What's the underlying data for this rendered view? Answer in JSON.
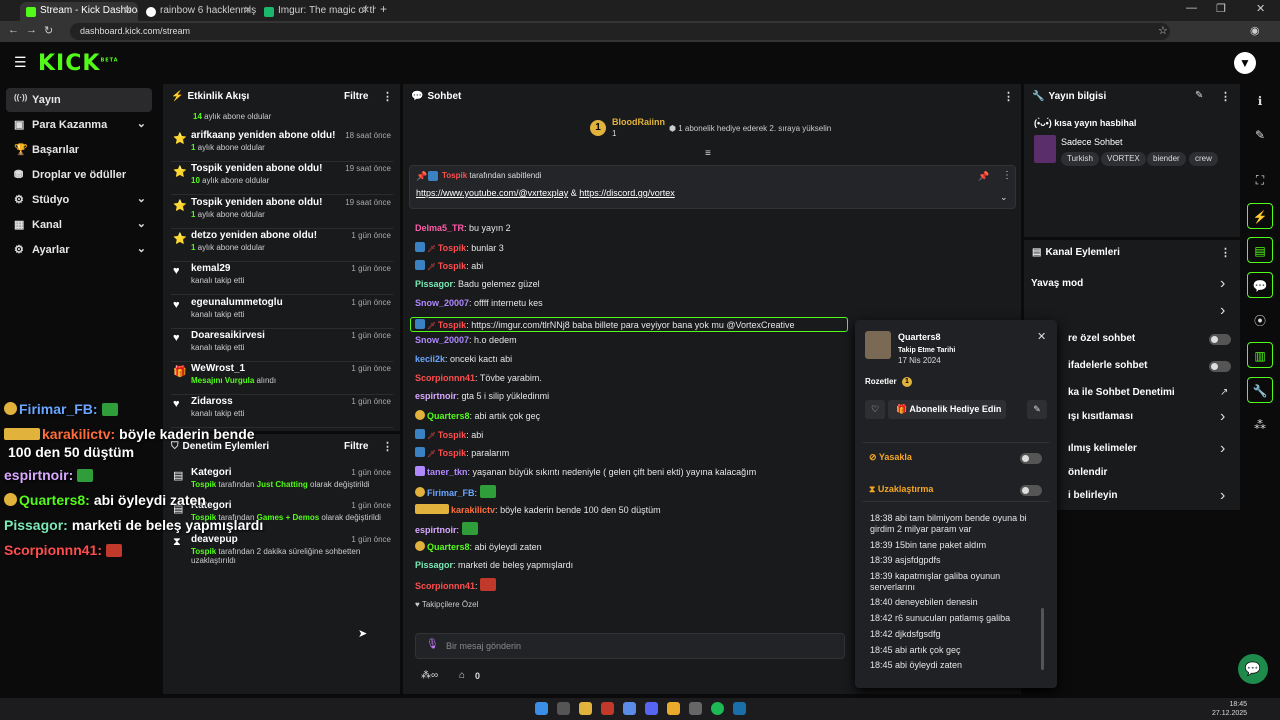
{
  "browser": {
    "tabs": [
      {
        "label": "Stream - Kick Dashboard",
        "color": "#53fc18",
        "active": true
      },
      {
        "label": "rainbow 6 hacklenmiş - Google",
        "color": "#4285f4",
        "active": false
      },
      {
        "label": "Imgur: The magic of the Interne",
        "color": "#1bb76e",
        "active": false
      }
    ],
    "url": "dashboard.kick.com/stream"
  },
  "brand": {
    "logo": "KICK",
    "beta": "BETA"
  },
  "leftnav": [
    {
      "label": "Yayın",
      "icon": "broadcast-icon",
      "glyph": "((·))",
      "chevron": false,
      "active": true
    },
    {
      "label": "Para Kazanma",
      "icon": "money-icon",
      "glyph": "▣",
      "chevron": true
    },
    {
      "label": "Başarılar",
      "icon": "trophy-icon",
      "glyph": "🏆",
      "chevron": false
    },
    {
      "label": "Droplar ve ödüller",
      "icon": "gift-icon",
      "glyph": "⛃",
      "chevron": false
    },
    {
      "label": "Stüdyo",
      "icon": "studio-icon",
      "glyph": "⚙",
      "chevron": true
    },
    {
      "label": "Kanal",
      "icon": "channel-icon",
      "glyph": "▦",
      "chevron": true
    },
    {
      "label": "Ayarlar",
      "icon": "settings-icon",
      "glyph": "⚙",
      "chevron": true
    }
  ],
  "activity": {
    "title": "Etkinlik Akışı",
    "filter": "Filtre",
    "top_line": {
      "bold": "14",
      "rest": " aylık abone oldular"
    },
    "items": [
      {
        "t1": "arifkaanp yeniden abone oldu!",
        "b": "1",
        "t2": " aylık abone oldular",
        "time": "18 saat önce",
        "icon": "star"
      },
      {
        "t1": "Tospik yeniden abone oldu!",
        "b": "10",
        "t2": " aylık abone oldular",
        "time": "19 saat önce",
        "icon": "star"
      },
      {
        "t1": "Tospik yeniden abone oldu!",
        "b": "1",
        "t2": " aylık abone oldular",
        "time": "19 saat önce",
        "icon": "star"
      },
      {
        "t1": "detzo yeniden abone oldu!",
        "b": "1",
        "t2": " aylık abone oldular",
        "time": "1 gün önce",
        "icon": "star"
      },
      {
        "t1": "kemal29",
        "b": "",
        "t2": "kanalı takip etti",
        "time": "1 gün önce",
        "icon": "heart"
      },
      {
        "t1": "egeunalummetoglu",
        "b": "",
        "t2": "kanalı takip etti",
        "time": "1 gün önce",
        "icon": "heart"
      },
      {
        "t1": "Doaresaikirvesi",
        "b": "",
        "t2": "kanalı takip etti",
        "time": "1 gün önce",
        "icon": "heart"
      },
      {
        "t1": "WeWrost_1",
        "b": "Mesajını Vurgula",
        "t2": " alındı",
        "time": "1 gün önce",
        "icon": "gift"
      },
      {
        "t1": "Zidaross",
        "b": "",
        "t2": "kanalı takip etti",
        "time": "1 gün önce",
        "icon": "heart"
      }
    ]
  },
  "moderation": {
    "title": "Denetim Eylemleri",
    "filter": "Filtre",
    "items": [
      {
        "t1": "Kategori",
        "b": "Tospik",
        "m": " tarafından ",
        "g": "Just Chatting",
        "e": " olarak değiştirildi",
        "time": "1 gün önce"
      },
      {
        "t1": "Kategori",
        "b": "Tospik",
        "m": " tarafından ",
        "g": "Games + Demos",
        "e": " olarak değiştirildi",
        "time": "1 gün önce"
      },
      {
        "t1": "deavepup",
        "b": "Tospik",
        "m": " tarafından 2 dakika süreliğine sohbetten",
        "g": "",
        "e": "uzaklaştırıldı",
        "time": "1 gün önce"
      }
    ]
  },
  "overlay": [
    {
      "user": "Firimar_FB:",
      "color": "#6aa6ff",
      "text": "",
      "emote": "#2f9e3a"
    },
    {
      "user": "karakilictv:",
      "color": "#ff6d3a",
      "text": "böyle kaderin bende",
      "emote": ""
    },
    {
      "user": "",
      "color": "#fff",
      "text": "100 den 50 düştüm",
      "emote": ""
    },
    {
      "user": "espirtnoir:",
      "color": "#d9a8ff",
      "text": "",
      "emote": "#2f9e3a"
    },
    {
      "user": "Quarters8:",
      "color": "#53fc18",
      "text": "abi öyleydi zaten",
      "emote": ""
    },
    {
      "user": "Pissagor:",
      "color": "#7be8b5",
      "text": "marketi de beleş yapmışlardı",
      "emote": ""
    },
    {
      "user": "Scorpionnn41:",
      "color": "#ff4d4d",
      "text": "",
      "emote": "#c0392b"
    }
  ],
  "chat": {
    "title": "Sohbet",
    "gift_user": "BloodRaiinn",
    "gift_count": "1",
    "gift_text": "1 abonelik hediye ederek 2. sıraya yükselin",
    "pinned_by": "Tospik",
    "pinned_suffix": " tarafından sabitlendi",
    "pinned_link1": "https://www.youtube.com/@vxrtexplay",
    "pinned_amp": " & ",
    "pinned_link2": "https://discord.gg/vortex",
    "messages": [
      {
        "user": "Delma5_TR",
        "color": "#ff5ca8",
        "text": "bu yayın 2",
        "mod": false
      },
      {
        "user": "Tospik",
        "color": "#ff4d4d",
        "text": "bunlar 3",
        "mod": true
      },
      {
        "user": "Tospik",
        "color": "#ff4d4d",
        "text": "abi",
        "mod": true
      },
      {
        "user": "Pissagor",
        "color": "#7be8b5",
        "text": "Badu gelemez güzel",
        "mod": false
      },
      {
        "user": "Snow_20007",
        "color": "#b088ff",
        "text": "offff internetu kes",
        "mod": false
      },
      {
        "user": "Tospik",
        "color": "#ff4d4d",
        "text": "https://imgur.com/tlrNNj8 baba billete para veyiyor bana yok mu @VortexCreative",
        "mod": true,
        "highlight": true
      },
      {
        "user": "Snow_20007",
        "color": "#b088ff",
        "text": "h.o dedem",
        "mod": false
      },
      {
        "user": "kecii2k",
        "color": "#6aa6ff",
        "text": "onceki kactı abi",
        "mod": false
      },
      {
        "user": "Scorpionnn41",
        "color": "#ff4d4d",
        "text": "Tövbe yarabim.",
        "mod": false
      },
      {
        "user": "espirtnoir",
        "color": "#d9a8ff",
        "text": "gta 5 i silip yükledinmi",
        "mod": false
      },
      {
        "user": "Quarters8",
        "color": "#53fc18",
        "text": "abi artık çok geç",
        "mod": false
      },
      {
        "user": "Tospik",
        "color": "#ff4d4d",
        "text": "abi",
        "mod": true
      },
      {
        "user": "Tospik",
        "color": "#ff4d4d",
        "text": "paralarım",
        "mod": true
      },
      {
        "user": "taner_tkn",
        "color": "#b088ff",
        "text": "yaşanan büyük sıkıntı nedeniyle ( gelen çift beni ekti) yayına kalacağım",
        "mod": false
      },
      {
        "user": "Firimar_FB",
        "color": "#6aa6ff",
        "text": "",
        "mod": false
      },
      {
        "user": "karakilictv",
        "color": "#ff6d3a",
        "text": "böyle kaderin bende 100 den 50 düştüm",
        "mod": false
      },
      {
        "user": "espirtnoir",
        "color": "#d9a8ff",
        "text": "",
        "mod": false
      },
      {
        "user": "Quarters8",
        "color": "#53fc18",
        "text": "abi öyleydi zaten",
        "mod": false
      },
      {
        "user": "Pissagor",
        "color": "#7be8b5",
        "text": "marketi de beleş yapmışlardı",
        "mod": false
      },
      {
        "user": "Scorpionnn41",
        "color": "#ff4d4d",
        "text": "",
        "mod": false
      }
    ],
    "followers_only": "Takipçilere Özel",
    "input_placeholder": "Bir mesaj gönderin",
    "points": "0"
  },
  "stream_info": {
    "title": "Yayın bilgisi",
    "stream_title": "(•̀ᴗ•́) kısa yayın hasbihal",
    "category": "Sadece Sohbet",
    "tags": [
      "Turkish",
      "VORTEX",
      "biender",
      "crew"
    ]
  },
  "channel_actions": {
    "title": "Kanal Eylemleri",
    "items": [
      {
        "label": "Yavaş mod",
        "type": "chevron"
      },
      {
        "label": "Takipçilere özel sohbet",
        "type": "chevron"
      },
      {
        "label": "re özel sohbet",
        "type": "toggle"
      },
      {
        "label": "ifadelerle sohbet",
        "type": "toggle"
      },
      {
        "label": "ka ile Sohbet Denetimi",
        "type": "external"
      },
      {
        "label": "ışı kısıtlaması",
        "type": "chevron"
      },
      {
        "label": "ılmış kelimeler",
        "type": "chevron"
      },
      {
        "label": "önlendir",
        "type": "none"
      },
      {
        "label": "i belirleyin",
        "type": "chevron"
      }
    ]
  },
  "user_card": {
    "username": "Quarters8",
    "follow_label": "Takip Etme Tarihi",
    "follow_date": "17 Nis 2024",
    "badges_label": "Rozetler",
    "gift_button": "Abonelik Hediye Edin",
    "ban_label": "Yasakla",
    "timeout_label": "Uzaklaştırma",
    "history": [
      "18:38 abi tam bilmiyom bende oyuna bi girdim 2 milyar param var",
      "18:39 15bin tane paket aldım",
      "18:39 asjsfdgpdfs",
      "18:39 kapatmışlar galiba oyunun serverlarını",
      "18:40 deneyebilen denesin",
      "18:42 r6 sunucuları patlamış galiba",
      "18:42 djkdsfgsdfg",
      "18:45 abi artık çok geç",
      "18:45 abi öyleydi zaten"
    ]
  },
  "taskbar": {
    "time": "18:45",
    "date": "27.12.2025"
  }
}
